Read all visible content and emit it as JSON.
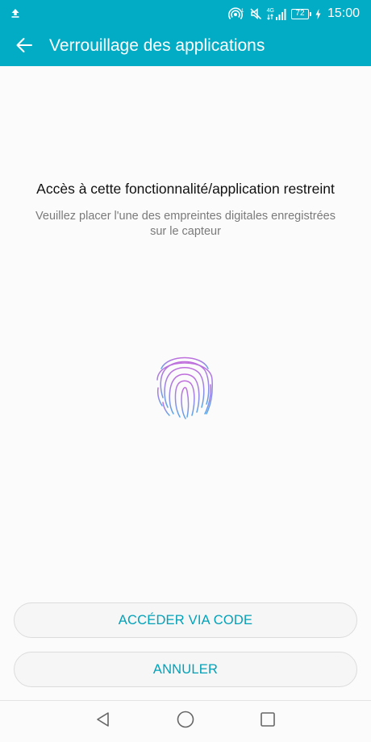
{
  "status_bar": {
    "time": "15:00",
    "battery_level": "72",
    "network_type": "4G",
    "icons": [
      "upload-icon",
      "hotspot-icon",
      "mute-icon",
      "signal-icon",
      "battery-icon",
      "charging-icon"
    ]
  },
  "app_bar": {
    "title": "Verrouillage des applications",
    "back_icon": "arrow-left-icon",
    "background_color": "#03acc5"
  },
  "content": {
    "heading": "Accès à cette fonctionnalité/application restreint",
    "subtext": "Veuillez placer l'une des empreintes digitales enregistrées sur le capteur",
    "icon": "fingerprint-icon"
  },
  "buttons": {
    "code_label": "ACCÉDER VIA CODE",
    "cancel_label": "ANNULER",
    "accent_color": "#02a1b8"
  },
  "nav_bar": {
    "icons": [
      "nav-back-icon",
      "nav-home-icon",
      "nav-recents-icon"
    ]
  }
}
